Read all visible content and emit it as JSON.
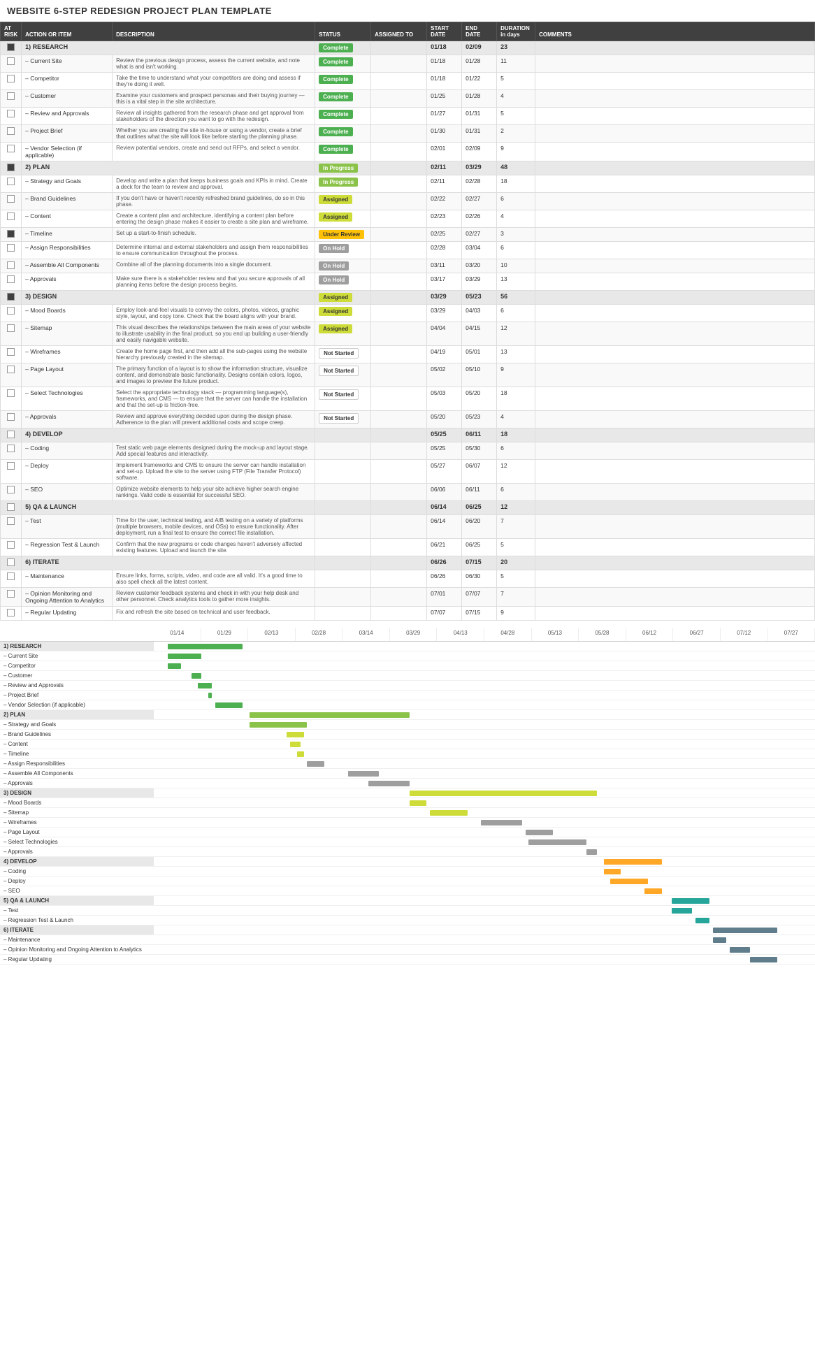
{
  "title": "WEBSITE 6-STEP REDESIGN PROJECT PLAN TEMPLATE",
  "table": {
    "headers": [
      "AT RISK",
      "ACTION OR ITEM",
      "DESCRIPTION",
      "STATUS",
      "ASSIGNED TO",
      "START DATE",
      "END DATE",
      "DURATION (in days)",
      "COMMENTS"
    ],
    "rows": [
      {
        "type": "section",
        "risk": true,
        "label": "1) RESEARCH",
        "status": "Complete",
        "status_type": "complete",
        "start": "01/18",
        "end": "02/09",
        "duration": "23"
      },
      {
        "type": "item",
        "risk": false,
        "label": "– Current Site",
        "desc": "Review the previous design process, assess the current website, and note what is and isn't working.",
        "status": "Complete",
        "status_type": "complete",
        "start": "01/18",
        "end": "01/28",
        "duration": "11"
      },
      {
        "type": "item",
        "risk": false,
        "label": "– Competitor",
        "desc": "Take the time to understand what your competitors are doing and assess if they're doing it well.",
        "status": "Complete",
        "status_type": "complete",
        "start": "01/18",
        "end": "01/22",
        "duration": "5"
      },
      {
        "type": "item",
        "risk": false,
        "label": "– Customer",
        "desc": "Examine your customers and prospect personas and their buying journey — this is a vital step in the site architecture.",
        "status": "Complete",
        "status_type": "complete",
        "start": "01/25",
        "end": "01/28",
        "duration": "4"
      },
      {
        "type": "item",
        "risk": false,
        "label": "– Review and Approvals",
        "desc": "Review all insights gathered from the research phase and get approval from stakeholders of the direction you want to go with the redesign.",
        "status": "Complete",
        "status_type": "complete",
        "start": "01/27",
        "end": "01/31",
        "duration": "5"
      },
      {
        "type": "item",
        "risk": false,
        "label": "– Project Brief",
        "desc": "Whether you are creating the site in-house or using a vendor, create a brief that outlines what the site will look like before starting the planning phase.",
        "status": "Complete",
        "status_type": "complete",
        "start": "01/30",
        "end": "01/31",
        "duration": "2"
      },
      {
        "type": "item",
        "risk": false,
        "label": "– Vendor Selection (if applicable)",
        "desc": "Review potential vendors, create and send out RFPs, and select a vendor.",
        "status": "Complete",
        "status_type": "complete",
        "start": "02/01",
        "end": "02/09",
        "duration": "9"
      },
      {
        "type": "section",
        "risk": true,
        "label": "2) PLAN",
        "status": "In Progress",
        "status_type": "inprogress",
        "start": "02/11",
        "end": "03/29",
        "duration": "48"
      },
      {
        "type": "item",
        "risk": false,
        "label": "– Strategy and Goals",
        "desc": "Develop and write a plan that keeps business goals and KPIs in mind. Create a deck for the team to review and approval.",
        "status": "In Progress",
        "status_type": "inprogress",
        "start": "02/11",
        "end": "02/28",
        "duration": "18"
      },
      {
        "type": "item",
        "risk": false,
        "label": "– Brand Guidelines",
        "desc": "If you don't have or haven't recently refreshed brand guidelines, do so in this phase.",
        "status": "Assigned",
        "status_type": "assigned",
        "start": "02/22",
        "end": "02/27",
        "duration": "6"
      },
      {
        "type": "item",
        "risk": false,
        "label": "– Content",
        "desc": "Create a content plan and architecture, identifying a content plan before entering the design phase makes it easier to create a site plan and wireframe.",
        "status": "Assigned",
        "status_type": "assigned",
        "start": "02/23",
        "end": "02/26",
        "duration": "4"
      },
      {
        "type": "item",
        "risk": true,
        "label": "– Timeline",
        "desc": "Set up a start-to-finish schedule.",
        "status": "Under Review",
        "status_type": "underreview",
        "start": "02/25",
        "end": "02/27",
        "duration": "3"
      },
      {
        "type": "item",
        "risk": false,
        "label": "– Assign Responsibilities",
        "desc": "Determine internal and external stakeholders and assign them responsibilities to ensure communication throughout the process.",
        "status": "On Hold",
        "status_type": "onhold",
        "start": "02/28",
        "end": "03/04",
        "duration": "6"
      },
      {
        "type": "item",
        "risk": false,
        "label": "– Assemble All Components",
        "desc": "Combine all of the planning documents into a single document.",
        "status": "On Hold",
        "status_type": "onhold",
        "start": "03/11",
        "end": "03/20",
        "duration": "10"
      },
      {
        "type": "item",
        "risk": false,
        "label": "– Approvals",
        "desc": "Make sure there is a stakeholder review and that you secure approvals of all planning items before the design process begins.",
        "status": "On Hold",
        "status_type": "onhold",
        "start": "03/17",
        "end": "03/29",
        "duration": "13"
      },
      {
        "type": "section",
        "risk": true,
        "label": "3) DESIGN",
        "status": "Assigned",
        "status_type": "assigned",
        "start": "03/29",
        "end": "05/23",
        "duration": "56"
      },
      {
        "type": "item",
        "risk": false,
        "label": "– Mood Boards",
        "desc": "Employ look-and-feel visuals to convey the colors, photos, videos, graphic style, layout, and copy tone. Check that the board aligns with your brand.",
        "status": "Assigned",
        "status_type": "assigned",
        "start": "03/29",
        "end": "04/03",
        "duration": "6"
      },
      {
        "type": "item",
        "risk": false,
        "label": "– Sitemap",
        "desc": "This visual describes the relationships between the main areas of your website to illustrate usability in the final product, so you end up building a user-friendly and easily navigable website.",
        "status": "Assigned",
        "status_type": "assigned",
        "start": "04/04",
        "end": "04/15",
        "duration": "12"
      },
      {
        "type": "item",
        "risk": false,
        "label": "– Wireframes",
        "desc": "Create the home page first, and then add all the sub-pages using the website hierarchy previously created in the sitemap.",
        "status": "Not Started",
        "status_type": "notstarted",
        "start": "04/19",
        "end": "05/01",
        "duration": "13"
      },
      {
        "type": "item",
        "risk": false,
        "label": "– Page Layout",
        "desc": "The primary function of a layout is to show the information structure, visualize content, and demonstrate basic functionality. Designs contain colors, logos, and images to preview the future product.",
        "status": "Not Started",
        "status_type": "notstarted",
        "start": "05/02",
        "end": "05/10",
        "duration": "9"
      },
      {
        "type": "item",
        "risk": false,
        "label": "– Select Technologies",
        "desc": "Select the appropriate technology stack — programming language(s), frameworks, and CMS — to ensure that the server can handle the installation and that the set-up is friction-free.",
        "status": "Not Started",
        "status_type": "notstarted",
        "start": "05/03",
        "end": "05/20",
        "duration": "18"
      },
      {
        "type": "item",
        "risk": false,
        "label": "– Approvals",
        "desc": "Review and approve everything decided upon during the design phase. Adherence to the plan will prevent additional costs and scope creep.",
        "status": "Not Started",
        "status_type": "notstarted",
        "start": "05/20",
        "end": "05/23",
        "duration": "4"
      },
      {
        "type": "section",
        "risk": false,
        "label": "4) DEVELOP",
        "status": "",
        "status_type": "",
        "start": "05/25",
        "end": "06/11",
        "duration": "18"
      },
      {
        "type": "item",
        "risk": false,
        "label": "– Coding",
        "desc": "Test static web page elements designed during the mock-up and layout stage. Add special features and interactivity.",
        "status": "",
        "status_type": "",
        "start": "05/25",
        "end": "05/30",
        "duration": "6"
      },
      {
        "type": "item",
        "risk": false,
        "label": "– Deploy",
        "desc": "Implement frameworks and CMS to ensure the server can handle installation and set-up. Upload the site to the server using FTP (File Transfer Protocol) software.",
        "status": "",
        "status_type": "",
        "start": "05/27",
        "end": "06/07",
        "duration": "12"
      },
      {
        "type": "item",
        "risk": false,
        "label": "– SEO",
        "desc": "Optimize website elements to help your site achieve higher search engine rankings. Valid code is essential for successful SEO.",
        "status": "",
        "status_type": "",
        "start": "06/06",
        "end": "06/11",
        "duration": "6"
      },
      {
        "type": "section",
        "risk": false,
        "label": "5) QA & LAUNCH",
        "status": "",
        "status_type": "",
        "start": "06/14",
        "end": "06/25",
        "duration": "12"
      },
      {
        "type": "item",
        "risk": false,
        "label": "– Test",
        "desc": "Time for the user, technical testing, and A/B testing on a variety of platforms (multiple browsers, mobile devices, and OSs) to ensure functionality. After deployment, run a final test to ensure the correct file installation.",
        "status": "",
        "status_type": "",
        "start": "06/14",
        "end": "06/20",
        "duration": "7"
      },
      {
        "type": "item",
        "risk": false,
        "label": "– Regression Test & Launch",
        "desc": "Confirm that the new programs or code changes haven't adversely affected existing features. Upload and launch the site.",
        "status": "",
        "status_type": "",
        "start": "06/21",
        "end": "06/25",
        "duration": "5"
      },
      {
        "type": "section",
        "risk": false,
        "label": "6) ITERATE",
        "status": "",
        "status_type": "",
        "start": "06/26",
        "end": "07/15",
        "duration": "20"
      },
      {
        "type": "item",
        "risk": false,
        "label": "– Maintenance",
        "desc": "Ensure links, forms, scripts, video, and code are all valid. It's a good time to also spell check all the latest content.",
        "status": "",
        "status_type": "",
        "start": "06/26",
        "end": "06/30",
        "duration": "5"
      },
      {
        "type": "item",
        "risk": false,
        "label": "– Opinion Monitoring and Ongoing Attention to Analytics",
        "desc": "Review customer feedback systems and check in with your help desk and other personnel. Check analytics tools to gather more insights.",
        "status": "",
        "status_type": "",
        "start": "07/01",
        "end": "07/07",
        "duration": "7"
      },
      {
        "type": "item",
        "risk": false,
        "label": "– Regular Updating",
        "desc": "Fix and refresh the site based on technical and user feedback.",
        "status": "",
        "status_type": "",
        "start": "07/07",
        "end": "07/15",
        "duration": "9"
      }
    ]
  },
  "gantt": {
    "dates": [
      "01/14",
      "01/29",
      "02/13",
      "02/28",
      "03/14",
      "03/29",
      "04/13",
      "04/28",
      "05/13",
      "05/28",
      "06/12",
      "06/27",
      "07/12",
      "07/27"
    ],
    "labels": [
      {
        "text": "1) RESEARCH",
        "type": "section"
      },
      {
        "text": "– Current Site",
        "type": "item"
      },
      {
        "text": "– Competitor",
        "type": "item"
      },
      {
        "text": "– Customer",
        "type": "item"
      },
      {
        "text": "– Review and Approvals",
        "type": "item"
      },
      {
        "text": "– Project Brief",
        "type": "item"
      },
      {
        "text": "– Vendor Selection (if applicable)",
        "type": "item"
      },
      {
        "text": "2) PLAN",
        "type": "section"
      },
      {
        "text": "– Strategy and Goals",
        "type": "item"
      },
      {
        "text": "– Brand Guidelines",
        "type": "item"
      },
      {
        "text": "– Content",
        "type": "item"
      },
      {
        "text": "– Timeline",
        "type": "item"
      },
      {
        "text": "– Assign Responsibilities",
        "type": "item"
      },
      {
        "text": "– Assemble All Components",
        "type": "item"
      },
      {
        "text": "– Approvals",
        "type": "item"
      },
      {
        "text": "3) DESIGN",
        "type": "section"
      },
      {
        "text": "– Mood Boards",
        "type": "item"
      },
      {
        "text": "– Sitemap",
        "type": "item"
      },
      {
        "text": "– Wireframes",
        "type": "item"
      },
      {
        "text": "– Page Layout",
        "type": "item"
      },
      {
        "text": "– Select Technologies",
        "type": "item"
      },
      {
        "text": "– Approvals",
        "type": "item"
      },
      {
        "text": "4) DEVELOP",
        "type": "section"
      },
      {
        "text": "– Coding",
        "type": "item"
      },
      {
        "text": "– Deploy",
        "type": "item"
      },
      {
        "text": "– SEO",
        "type": "item"
      },
      {
        "text": "5) QA & LAUNCH",
        "type": "section"
      },
      {
        "text": "– Test",
        "type": "item"
      },
      {
        "text": "– Regression Test & Launch",
        "type": "item"
      },
      {
        "text": "6) ITERATE",
        "type": "section"
      },
      {
        "text": "– Maintenance",
        "type": "item"
      },
      {
        "text": "– Opinion Monitoring and Ongoing Attention to Analytics",
        "type": "item"
      },
      {
        "text": "– Regular Updating",
        "type": "item"
      }
    ],
    "bars": [
      {
        "start": 0.3,
        "width": 0.17,
        "color": "bar-green"
      },
      {
        "start": 0.3,
        "width": 0.07,
        "color": "bar-green"
      },
      {
        "start": 0.3,
        "width": 0.03,
        "color": "bar-green"
      },
      {
        "start": 0.35,
        "width": 0.03,
        "color": "bar-green"
      },
      {
        "start": 0.36,
        "width": 0.03,
        "color": "bar-green"
      },
      {
        "start": 0.37,
        "width": 0.01,
        "color": "bar-green"
      },
      {
        "start": 0.39,
        "width": 0.06,
        "color": "bar-green"
      },
      {
        "start": 0.44,
        "width": 0.36,
        "color": "bar-lightgreen"
      },
      {
        "start": 0.44,
        "width": 0.13,
        "color": "bar-lightgreen"
      },
      {
        "start": 0.51,
        "width": 0.04,
        "color": "bar-yellow"
      },
      {
        "start": 0.52,
        "width": 0.03,
        "color": "bar-yellow"
      },
      {
        "start": 0.53,
        "width": 0.02,
        "color": "bar-yellow"
      },
      {
        "start": 0.55,
        "width": 0.04,
        "color": "bar-gray"
      },
      {
        "start": 0.61,
        "width": 0.07,
        "color": "bar-gray"
      },
      {
        "start": 0.64,
        "width": 0.09,
        "color": "bar-gray"
      },
      {
        "start": 0.72,
        "width": 0.4,
        "color": "bar-yellow"
      },
      {
        "start": 0.72,
        "width": 0.04,
        "color": "bar-yellow"
      },
      {
        "start": 0.76,
        "width": 0.08,
        "color": "bar-yellow"
      },
      {
        "start": 0.83,
        "width": 0.09,
        "color": "bar-gray"
      },
      {
        "start": 0.87,
        "width": 0.06,
        "color": "bar-gray"
      },
      {
        "start": 0.87,
        "width": 0.12,
        "color": "bar-gray"
      },
      {
        "start": 0.97,
        "width": 0.03,
        "color": "bar-gray"
      },
      {
        "start": 0.995,
        "width": 0.13,
        "color": "bar-orange"
      },
      {
        "start": 0.995,
        "width": 0.04,
        "color": "bar-orange"
      },
      {
        "start": 1.01,
        "width": 0.08,
        "color": "bar-orange"
      },
      {
        "start": 1.06,
        "width": 0.04,
        "color": "bar-orange"
      },
      {
        "start": 1.1,
        "width": 0.09,
        "color": "bar-teal"
      },
      {
        "start": 1.1,
        "width": 0.05,
        "color": "bar-teal"
      },
      {
        "start": 1.14,
        "width": 0.03,
        "color": "bar-teal"
      },
      {
        "start": 1.17,
        "width": 0.15,
        "color": "bar-darkgray"
      },
      {
        "start": 1.17,
        "width": 0.03,
        "color": "bar-darkgray"
      },
      {
        "start": 1.19,
        "width": 0.05,
        "color": "bar-darkgray"
      },
      {
        "start": 1.23,
        "width": 0.06,
        "color": "bar-darkgray"
      }
    ]
  }
}
